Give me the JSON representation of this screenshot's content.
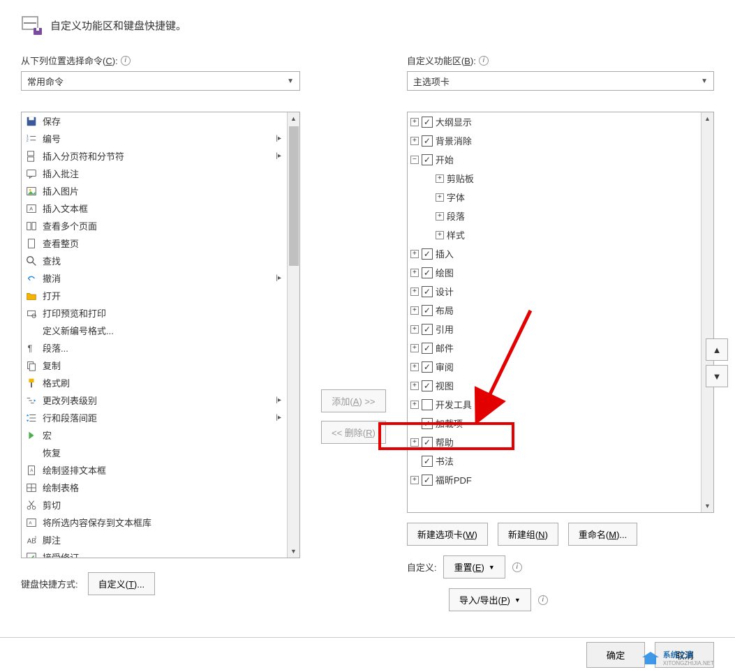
{
  "header": {
    "title": "自定义功能区和键盘快捷键。"
  },
  "leftLabel": "从下列位置选择命令(C):",
  "leftDropdown": "常用命令",
  "rightLabel": "自定义功能区(B):",
  "rightDropdown": "主选项卡",
  "commands": [
    {
      "icon": "save",
      "label": "保存",
      "arrow": false
    },
    {
      "icon": "numbering",
      "label": "编号",
      "arrow": true
    },
    {
      "icon": "pagebreak",
      "label": "插入分页符和分节符",
      "arrow": true
    },
    {
      "icon": "comment",
      "label": "插入批注",
      "arrow": false
    },
    {
      "icon": "picture",
      "label": "插入图片",
      "arrow": false
    },
    {
      "icon": "textbox",
      "label": "插入文本框",
      "arrow": false
    },
    {
      "icon": "multipage",
      "label": "查看多个页面",
      "arrow": false
    },
    {
      "icon": "page",
      "label": "查看整页",
      "arrow": false
    },
    {
      "icon": "find",
      "label": "查找",
      "arrow": false
    },
    {
      "icon": "undo",
      "label": "撤消",
      "arrow": true
    },
    {
      "icon": "open",
      "label": "打开",
      "arrow": false
    },
    {
      "icon": "printpreview",
      "label": "打印预览和打印",
      "arrow": false
    },
    {
      "icon": "blank",
      "label": "定义新编号格式...",
      "arrow": false
    },
    {
      "icon": "paragraph",
      "label": "段落...",
      "arrow": false
    },
    {
      "icon": "copy",
      "label": "复制",
      "arrow": false
    },
    {
      "icon": "formatpainter",
      "label": "格式刷",
      "arrow": false
    },
    {
      "icon": "listlevel",
      "label": "更改列表级别",
      "arrow": true
    },
    {
      "icon": "linespacing",
      "label": "行和段落间距",
      "arrow": true
    },
    {
      "icon": "macro",
      "label": "宏",
      "arrow": false
    },
    {
      "icon": "blank",
      "label": "恢复",
      "arrow": false
    },
    {
      "icon": "verttextbox",
      "label": "绘制竖排文本框",
      "arrow": false
    },
    {
      "icon": "table",
      "label": "绘制表格",
      "arrow": false
    },
    {
      "icon": "cut",
      "label": "剪切",
      "arrow": false
    },
    {
      "icon": "savetextbox",
      "label": "将所选内容保存到文本框库",
      "arrow": false
    },
    {
      "icon": "footnote",
      "label": "脚注",
      "arrow": false
    },
    {
      "icon": "accept",
      "label": "接受修订",
      "arrow": false
    }
  ],
  "tabs": [
    {
      "expand": "+",
      "checked": true,
      "label": "大纲显示",
      "indent": 0
    },
    {
      "expand": "+",
      "checked": true,
      "label": "背景消除",
      "indent": 0
    },
    {
      "expand": "−",
      "checked": true,
      "label": "开始",
      "indent": 0
    },
    {
      "expand": "+",
      "checked": null,
      "label": "剪贴板",
      "indent": 1
    },
    {
      "expand": "+",
      "checked": null,
      "label": "字体",
      "indent": 1
    },
    {
      "expand": "+",
      "checked": null,
      "label": "段落",
      "indent": 1
    },
    {
      "expand": "+",
      "checked": null,
      "label": "样式",
      "indent": 1
    },
    {
      "expand": "+",
      "checked": true,
      "label": "插入",
      "indent": 0
    },
    {
      "expand": "+",
      "checked": true,
      "label": "绘图",
      "indent": 0
    },
    {
      "expand": "+",
      "checked": true,
      "label": "设计",
      "indent": 0
    },
    {
      "expand": "+",
      "checked": true,
      "label": "布局",
      "indent": 0
    },
    {
      "expand": "+",
      "checked": true,
      "label": "引用",
      "indent": 0
    },
    {
      "expand": "+",
      "checked": true,
      "label": "邮件",
      "indent": 0
    },
    {
      "expand": "+",
      "checked": true,
      "label": "审阅",
      "indent": 0
    },
    {
      "expand": "+",
      "checked": true,
      "label": "视图",
      "indent": 0
    },
    {
      "expand": "+",
      "checked": false,
      "label": "开发工具",
      "indent": 0
    },
    {
      "expand": "",
      "checked": true,
      "label": "加载项",
      "indent": 0
    },
    {
      "expand": "+",
      "checked": true,
      "label": "帮助",
      "indent": 0
    },
    {
      "expand": "",
      "checked": true,
      "label": "书法",
      "indent": 0
    },
    {
      "expand": "+",
      "checked": true,
      "label": "福昕PDF",
      "indent": 0
    }
  ],
  "addBtn": "添加(A) >>",
  "removeBtn": "<< 删除(R)",
  "newTabBtn": "新建选项卡(W)",
  "newGroupBtn": "新建组(N)",
  "renameBtn": "重命名(M)...",
  "customLabel": "自定义:",
  "resetBtn": "重置(E)",
  "importExportBtn": "导入/导出(P)",
  "keyboardLabel": "键盘快捷方式:",
  "customizeBtn": "自定义(T)...",
  "okBtn": "确定",
  "cancelBtn": "取消",
  "watermark": "系统之家",
  "watermarkUrl": "XITONGZHIJIA.NET"
}
